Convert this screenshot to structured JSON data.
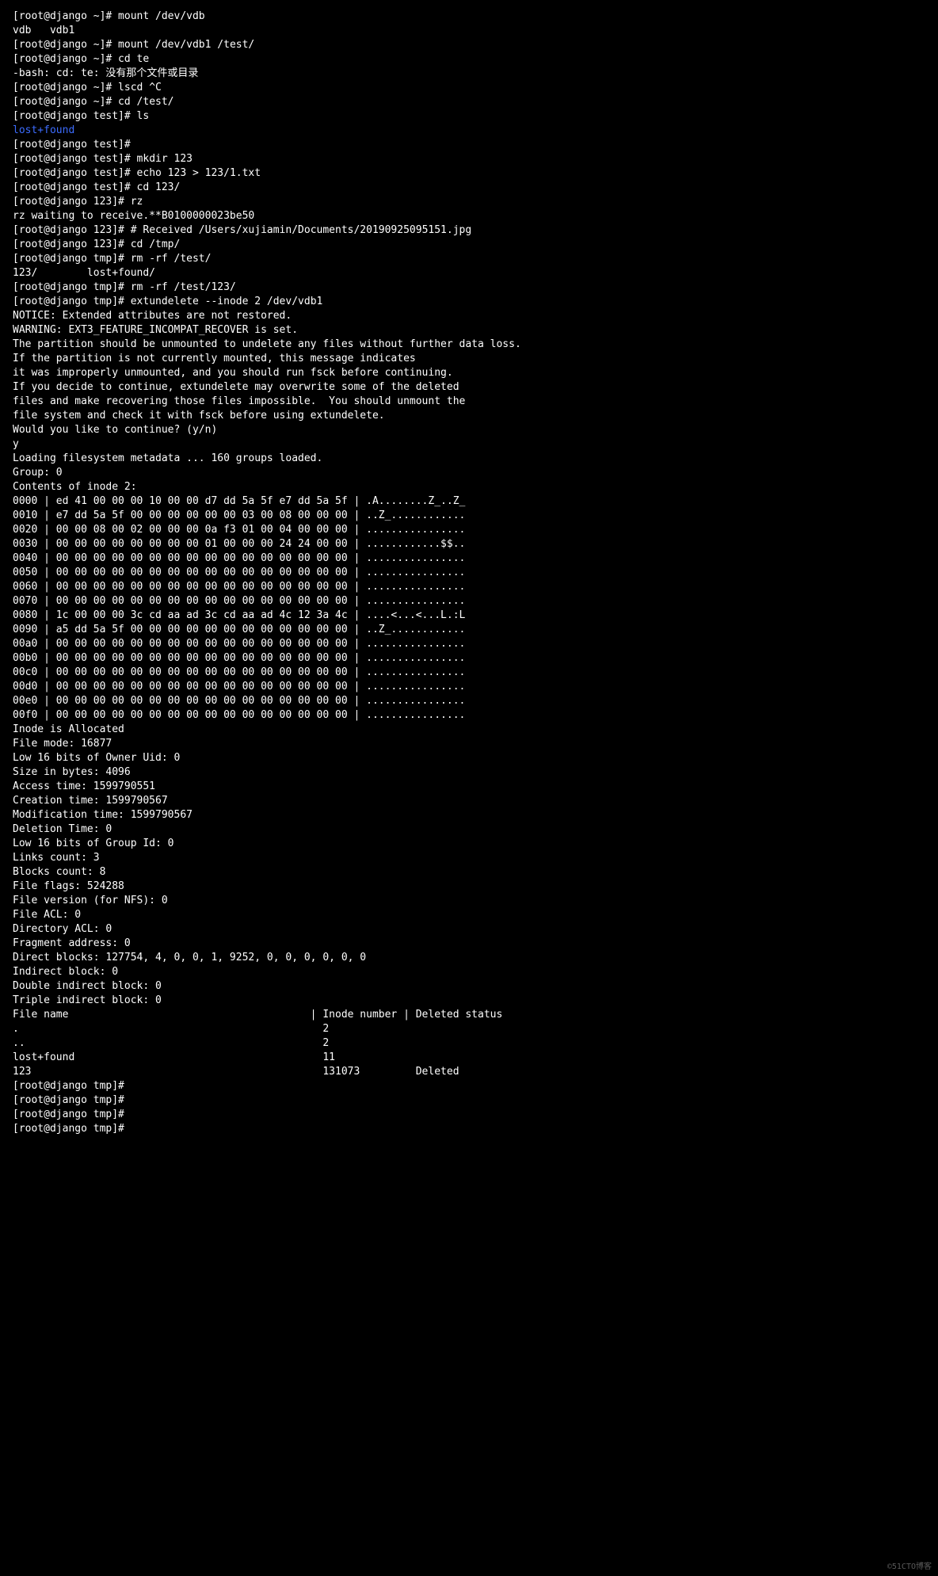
{
  "lines": [
    {
      "prompt": "[root@django ~]#",
      "cmd": " mount /dev/vdb"
    },
    {
      "text": "vdb   vdb1"
    },
    {
      "prompt": "[root@django ~]#",
      "cmd": " mount /dev/vdb1 /test/"
    },
    {
      "prompt": "[root@django ~]#",
      "cmd": " cd te"
    },
    {
      "text": "-bash: cd: te: 没有那个文件或目录"
    },
    {
      "prompt": "[root@django ~]#",
      "cmd": " lscd ^C"
    },
    {
      "prompt": "[root@django ~]#",
      "cmd": " cd /test/"
    },
    {
      "prompt": "[root@django test]#",
      "cmd": " ls"
    },
    {
      "text": "lost+found",
      "class": "dir-link"
    },
    {
      "prompt": "[root@django test]#",
      "cmd": ""
    },
    {
      "prompt": "[root@django test]#",
      "cmd": " mkdir 123"
    },
    {
      "prompt": "[root@django test]#",
      "cmd": " echo 123 > 123/1.txt"
    },
    {
      "prompt": "[root@django test]#",
      "cmd": " cd 123/"
    },
    {
      "prompt": "[root@django 123]#",
      "cmd": " rz"
    },
    {
      "text": "rz waiting to receive.**B0100000023be50"
    },
    {
      "prompt": "[root@django 123]#",
      "cmd": " # Received /Users/xujiamin/Documents/20190925095151.jpg"
    },
    {
      "prompt": "[root@django 123]#",
      "cmd": " cd /tmp/"
    },
    {
      "prompt": "[root@django tmp]#",
      "cmd": " rm -rf /test/"
    },
    {
      "text": "123/        lost+found/"
    },
    {
      "prompt": "[root@django tmp]#",
      "cmd": " rm -rf /test/123/"
    },
    {
      "prompt": "[root@django tmp]#",
      "cmd": " extundelete --inode 2 /dev/vdb1"
    },
    {
      "text": "NOTICE: Extended attributes are not restored."
    },
    {
      "text": "WARNING: EXT3_FEATURE_INCOMPAT_RECOVER is set."
    },
    {
      "text": "The partition should be unmounted to undelete any files without further data loss."
    },
    {
      "text": "If the partition is not currently mounted, this message indicates"
    },
    {
      "text": "it was improperly unmounted, and you should run fsck before continuing."
    },
    {
      "text": "If you decide to continue, extundelete may overwrite some of the deleted"
    },
    {
      "text": "files and make recovering those files impossible.  You should unmount the"
    },
    {
      "text": "file system and check it with fsck before using extundelete."
    },
    {
      "text": "Would you like to continue? (y/n)"
    },
    {
      "text": "y"
    },
    {
      "text": "Loading filesystem metadata ... 160 groups loaded."
    },
    {
      "text": "Group: 0"
    },
    {
      "text": "Contents of inode 2:"
    },
    {
      "text": "0000 | ed 41 00 00 00 10 00 00 d7 dd 5a 5f e7 dd 5a 5f | .A........Z_..Z_"
    },
    {
      "text": "0010 | e7 dd 5a 5f 00 00 00 00 00 00 03 00 08 00 00 00 | ..Z_............"
    },
    {
      "text": "0020 | 00 00 08 00 02 00 00 00 0a f3 01 00 04 00 00 00 | ................"
    },
    {
      "text": "0030 | 00 00 00 00 00 00 00 00 01 00 00 00 24 24 00 00 | ............$$.."
    },
    {
      "text": "0040 | 00 00 00 00 00 00 00 00 00 00 00 00 00 00 00 00 | ................"
    },
    {
      "text": "0050 | 00 00 00 00 00 00 00 00 00 00 00 00 00 00 00 00 | ................"
    },
    {
      "text": "0060 | 00 00 00 00 00 00 00 00 00 00 00 00 00 00 00 00 | ................"
    },
    {
      "text": "0070 | 00 00 00 00 00 00 00 00 00 00 00 00 00 00 00 00 | ................"
    },
    {
      "text": "0080 | 1c 00 00 00 3c cd aa ad 3c cd aa ad 4c 12 3a 4c | ....<...<...L.:L"
    },
    {
      "text": "0090 | a5 dd 5a 5f 00 00 00 00 00 00 00 00 00 00 00 00 | ..Z_............"
    },
    {
      "text": "00a0 | 00 00 00 00 00 00 00 00 00 00 00 00 00 00 00 00 | ................"
    },
    {
      "text": "00b0 | 00 00 00 00 00 00 00 00 00 00 00 00 00 00 00 00 | ................"
    },
    {
      "text": "00c0 | 00 00 00 00 00 00 00 00 00 00 00 00 00 00 00 00 | ................"
    },
    {
      "text": "00d0 | 00 00 00 00 00 00 00 00 00 00 00 00 00 00 00 00 | ................"
    },
    {
      "text": "00e0 | 00 00 00 00 00 00 00 00 00 00 00 00 00 00 00 00 | ................"
    },
    {
      "text": "00f0 | 00 00 00 00 00 00 00 00 00 00 00 00 00 00 00 00 | ................"
    },
    {
      "text": ""
    },
    {
      "text": "Inode is Allocated"
    },
    {
      "text": "File mode: 16877"
    },
    {
      "text": "Low 16 bits of Owner Uid: 0"
    },
    {
      "text": "Size in bytes: 4096"
    },
    {
      "text": "Access time: 1599790551"
    },
    {
      "text": "Creation time: 1599790567"
    },
    {
      "text": "Modification time: 1599790567"
    },
    {
      "text": "Deletion Time: 0"
    },
    {
      "text": "Low 16 bits of Group Id: 0"
    },
    {
      "text": "Links count: 3"
    },
    {
      "text": "Blocks count: 8"
    },
    {
      "text": "File flags: 524288"
    },
    {
      "text": "File version (for NFS): 0"
    },
    {
      "text": "File ACL: 0"
    },
    {
      "text": "Directory ACL: 0"
    },
    {
      "text": "Fragment address: 0"
    },
    {
      "text": "Direct blocks: 127754, 4, 0, 0, 1, 9252, 0, 0, 0, 0, 0, 0"
    },
    {
      "text": "Indirect block: 0"
    },
    {
      "text": "Double indirect block: 0"
    },
    {
      "text": "Triple indirect block: 0"
    },
    {
      "text": ""
    },
    {
      "text": "File name                                       | Inode number | Deleted status"
    },
    {
      "text": ".                                                 2"
    },
    {
      "text": "..                                                2"
    },
    {
      "text": "lost+found                                        11"
    },
    {
      "text": "123                                               131073         Deleted"
    },
    {
      "prompt": "[root@django tmp]#",
      "cmd": ""
    },
    {
      "prompt": "[root@django tmp]#",
      "cmd": ""
    },
    {
      "prompt": "[root@django tmp]#",
      "cmd": ""
    },
    {
      "prompt": "[root@django tmp]#",
      "cmd": ""
    }
  ],
  "watermark": "©51CTO博客"
}
